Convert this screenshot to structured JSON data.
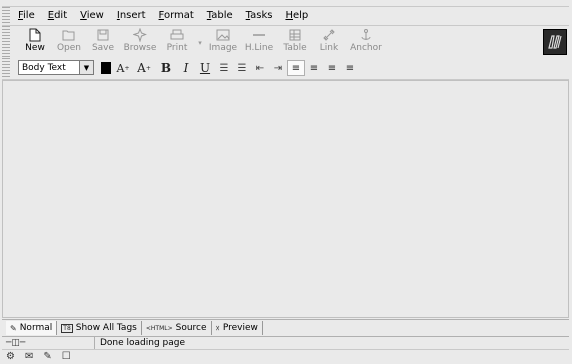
{
  "menubar": {
    "items": [
      "File",
      "Edit",
      "View",
      "Insert",
      "Format",
      "Table",
      "Tasks",
      "Help"
    ]
  },
  "toolbar": {
    "buttons": [
      {
        "label": "New",
        "icon": "new-page-icon",
        "enabled": true
      },
      {
        "label": "Open",
        "icon": "open-folder-icon",
        "enabled": false
      },
      {
        "label": "Save",
        "icon": "save-disk-icon",
        "enabled": false
      },
      {
        "label": "Browse",
        "icon": "browse-icon",
        "enabled": false
      },
      {
        "label": "Print",
        "icon": "print-icon",
        "enabled": false
      },
      {
        "label": "Image",
        "icon": "image-icon",
        "enabled": false
      },
      {
        "label": "H.Line",
        "icon": "hline-icon",
        "enabled": false
      },
      {
        "label": "Table",
        "icon": "table-icon",
        "enabled": false
      },
      {
        "label": "Link",
        "icon": "link-icon",
        "enabled": false
      },
      {
        "label": "Anchor",
        "icon": "anchor-icon",
        "enabled": false
      }
    ],
    "logo_icon": "composer-logo-icon"
  },
  "format": {
    "paragraph_style": "Body Text",
    "text_color": "#000000",
    "buttons": {
      "smaller_font": "A",
      "larger_font": "A",
      "bold": "B",
      "italic": "I",
      "underline": "U"
    }
  },
  "tabs": [
    {
      "label": "Normal",
      "icon": "pen-icon",
      "active": true
    },
    {
      "label": "Show All Tags",
      "icon": "tags-icon",
      "active": false
    },
    {
      "label": "Source",
      "icon": "html-source-icon",
      "prefix": "<HTML>",
      "active": false
    },
    {
      "label": "Preview",
      "icon": "preview-icon",
      "active": false
    }
  ],
  "status": {
    "text": "Done loading page"
  },
  "taskbar": {
    "icons": [
      "navigator-icon",
      "mail-icon",
      "composer-icon",
      "address-book-icon"
    ]
  },
  "colors": {
    "background": "#eaeaea",
    "disabled_text": "#8a8a8a"
  }
}
